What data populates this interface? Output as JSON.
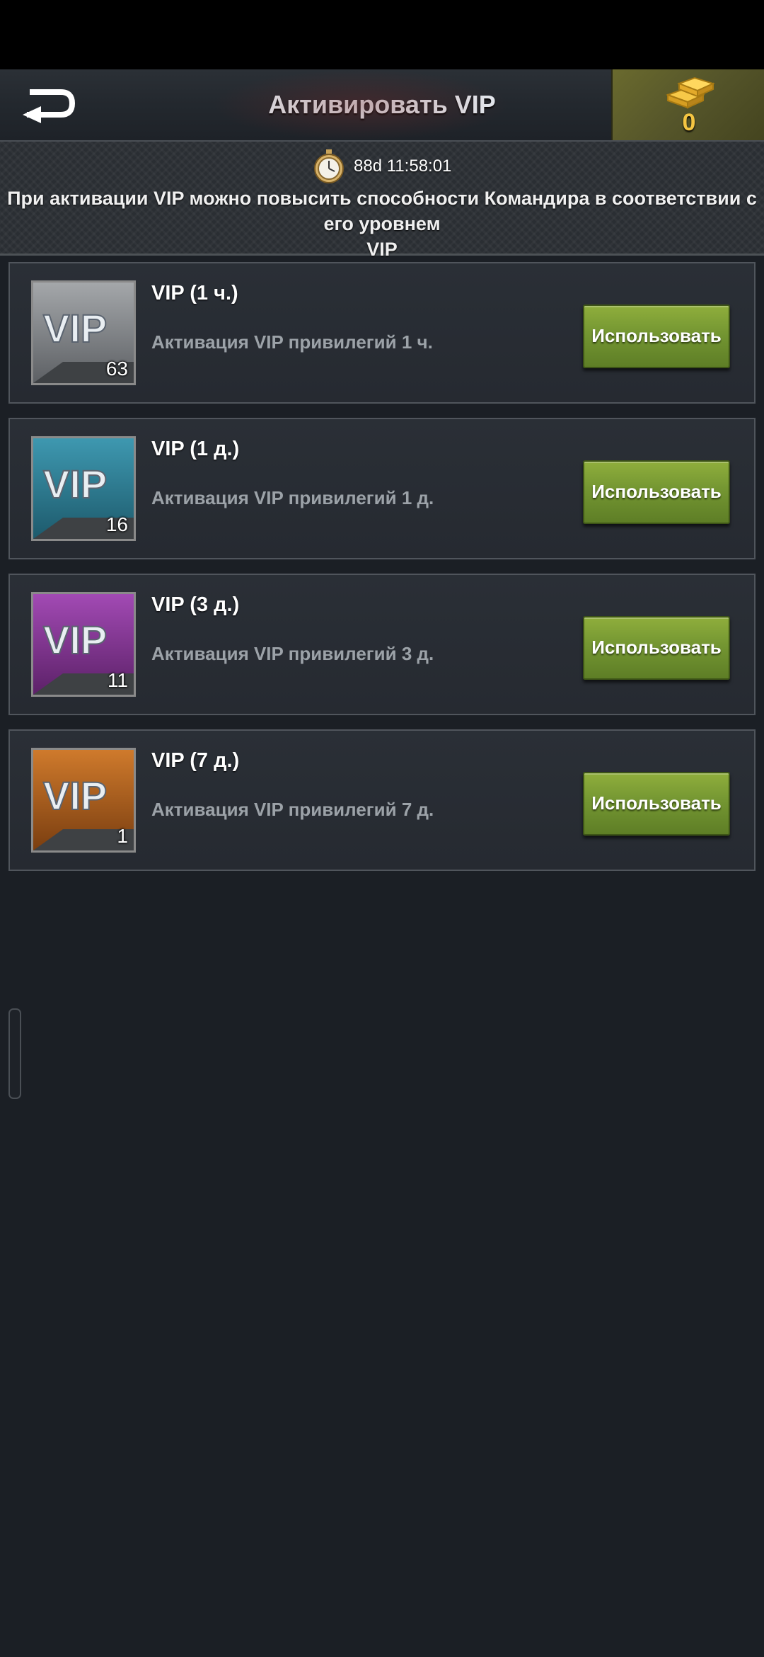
{
  "header": {
    "title": "Активировать VIP",
    "gold_count": "0"
  },
  "banner": {
    "timer": "88d 11:58:01",
    "text_line1": "При активации VIP можно повысить способности Командира в соответствии с его уровнем",
    "text_line2": "VIP"
  },
  "items": [
    {
      "title": "VIP (1 ч.)",
      "description": "Активация VIP привилегий 1 ч.",
      "count": "63",
      "button": "Использовать",
      "color": "#8a8d91"
    },
    {
      "title": "VIP (1 д.)",
      "description": "Активация VIP привилегий 1 д.",
      "count": "16",
      "button": "Использовать",
      "color": "#2f7f96"
    },
    {
      "title": "VIP (3 д.)",
      "description": "Активация VIP привилегий 3 д.",
      "count": "11",
      "button": "Использовать",
      "color": "#8a3a9a"
    },
    {
      "title": "VIP (7 д.)",
      "description": "Активация VIP привилегий 7 д.",
      "count": "1",
      "button": "Использовать",
      "color": "#b8641f"
    }
  ],
  "icons": {
    "back": "back-arrow-icon",
    "gold": "gold-bars-icon",
    "timer": "stopwatch-icon",
    "vip": "vip-badge-icon"
  }
}
